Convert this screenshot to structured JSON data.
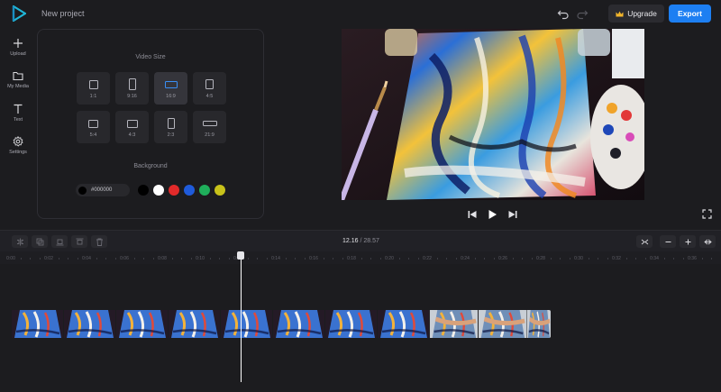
{
  "app": {
    "project_title": "New project",
    "upgrade_label": "Upgrade",
    "export_label": "Export",
    "accent_color": "#1d7ff2"
  },
  "sidebar": {
    "items": [
      {
        "label": "Upload",
        "icon": "plus-icon"
      },
      {
        "label": "My Media",
        "icon": "folder-icon"
      },
      {
        "label": "Text",
        "icon": "text-icon"
      },
      {
        "label": "Settings",
        "icon": "gear-icon"
      }
    ]
  },
  "panel": {
    "video_size_heading": "Video Size",
    "sizes": [
      "1:1",
      "9:16",
      "16:9",
      "4:5",
      "5:4",
      "4:3",
      "2:3",
      "21:9"
    ],
    "selected_size": "16:9",
    "background_heading": "Background",
    "background_hex": "#000000",
    "swatches": [
      "#000000",
      "#ffffff",
      "#e22a2a",
      "#1f5bdb",
      "#1fae5b",
      "#c8c21a"
    ]
  },
  "player": {
    "controls": [
      "skip-back-icon",
      "play-icon",
      "skip-forward-icon",
      "fullscreen-icon"
    ]
  },
  "timeline": {
    "current_time": "12.16",
    "separator": "/",
    "total_time": "28.57",
    "ruler_ticks": [
      "0:00",
      "0:02",
      "0:04",
      "0:06",
      "0:08",
      "0:10",
      "0:12",
      "0:14",
      "0:16",
      "0:18",
      "0:20",
      "0:22",
      "0:24",
      "0:26",
      "0:28",
      "0:30",
      "0:32",
      "0:34",
      "0:36"
    ],
    "clip_count": 11
  }
}
